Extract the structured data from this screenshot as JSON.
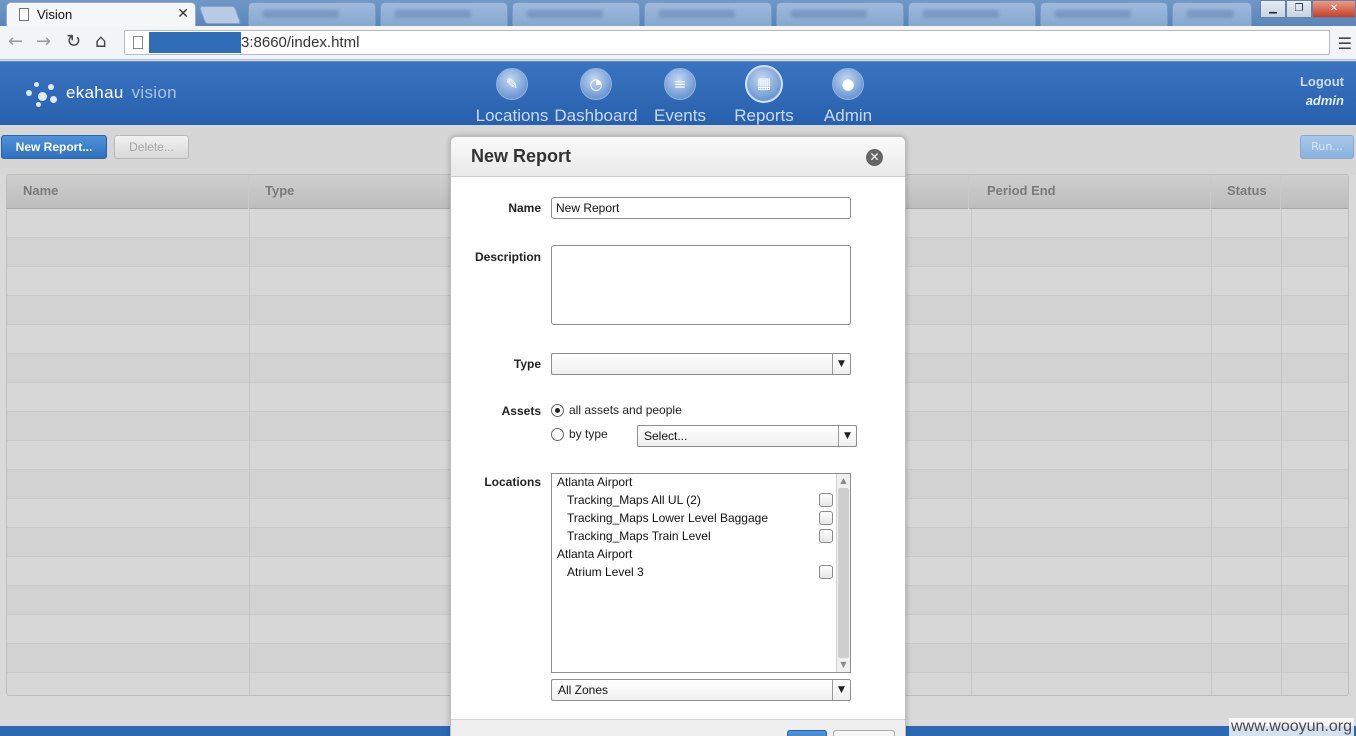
{
  "browser": {
    "tab_title": "Vision",
    "tab_close": "✕",
    "url": "3:8660/index.html",
    "window_buttons": [
      "▁",
      "❐",
      "✕"
    ]
  },
  "app": {
    "logo_primary": "ekahau",
    "logo_secondary": "vision",
    "nav": [
      {
        "label": "Locations",
        "icon": "pin-icon",
        "glyph": "✎"
      },
      {
        "label": "Dashboard",
        "icon": "gauge-icon",
        "glyph": "◔"
      },
      {
        "label": "Events",
        "icon": "list-icon",
        "glyph": "≡"
      },
      {
        "label": "Reports",
        "icon": "chart-icon",
        "glyph": "▦"
      },
      {
        "label": "Admin",
        "icon": "user-icon",
        "glyph": "●"
      }
    ],
    "logout_label": "Logout",
    "username": "admin"
  },
  "toolbar": {
    "new_report_label": "New Report...",
    "delete_label": "Delete...",
    "right_button_label": "Run..."
  },
  "table": {
    "columns": [
      "Name",
      "Type",
      "Period End",
      "Status"
    ]
  },
  "modal": {
    "title": "New Report",
    "close_glyph": "✕",
    "name_label": "Name",
    "name_value": "New Report",
    "description_label": "Description",
    "description_value": "",
    "type_label": "Type",
    "type_value": "",
    "assets_label": "Assets",
    "assets_option_all": "all assets and people",
    "assets_option_type": "by type",
    "assets_type_select": "Select...",
    "locations_label": "Locations",
    "location_groups": [
      {
        "name": "Atlanta Airport",
        "items": [
          "Tracking_Maps All UL (2)",
          "Tracking_Maps Lower Level Baggage",
          "Tracking_Maps Train Level"
        ]
      },
      {
        "name": "Atlanta Airport",
        "items": [
          "Atrium Level 3"
        ]
      }
    ],
    "zones_select": "All Zones"
  },
  "watermark": "www.wooyun.org",
  "colors": {
    "header_blue": "#2f6bb6",
    "primary_button": "#3a7ec9"
  }
}
